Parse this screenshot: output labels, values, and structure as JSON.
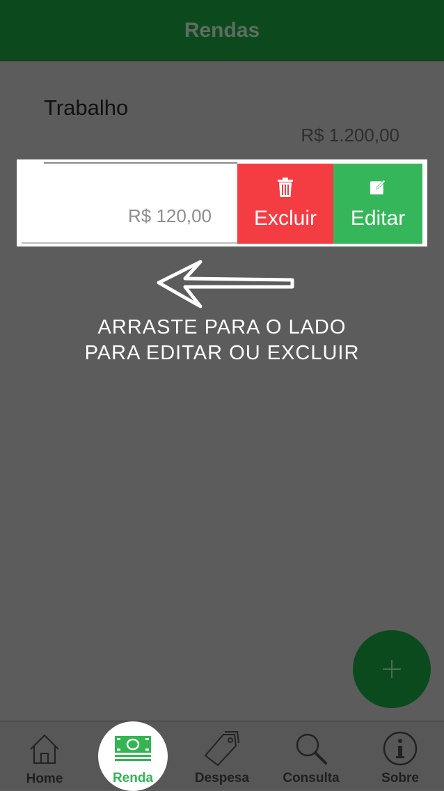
{
  "header": {
    "title": "Rendas"
  },
  "list": {
    "items": [
      {
        "name": "Trabalho",
        "amount": "R$ 1.200,00"
      },
      {
        "name": "",
        "amount": "R$ 120,00"
      }
    ],
    "swipe_actions": {
      "delete_label": "Excluir",
      "edit_label": "Editar"
    }
  },
  "hint": {
    "line1": "ARRASTE PARA O LADO",
    "line2": "PARA EDITAR OU EXCLUIR"
  },
  "fab": {
    "icon": "plus-icon"
  },
  "bottom_nav": {
    "items": [
      {
        "label": "Home",
        "icon": "home-icon"
      },
      {
        "label": "Renda",
        "icon": "money-icon"
      },
      {
        "label": "Despesa",
        "icon": "tag-icon"
      },
      {
        "label": "Consulta",
        "icon": "search-icon"
      },
      {
        "label": "Sobre",
        "icon": "info-icon"
      }
    ],
    "active": "Renda"
  },
  "colors": {
    "header": "#0c4a1e",
    "delete": "#f43c43",
    "edit": "#36b65a",
    "active_nav": "#33b552"
  }
}
